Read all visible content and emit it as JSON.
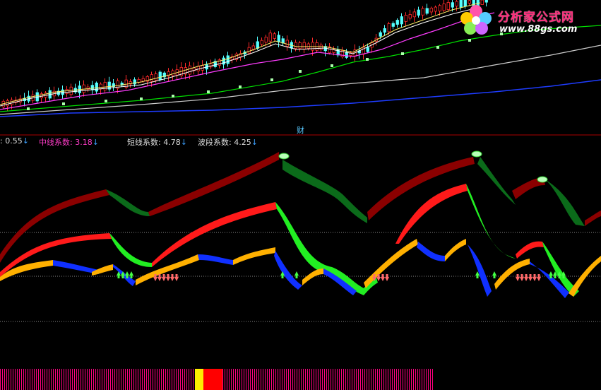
{
  "panel_label": "财",
  "indicators": [
    {
      "label": "",
      "value": ": 0.55",
      "arrow": "↓",
      "color": "#dddddd"
    },
    {
      "label": "中线系数",
      "value": ": 3.18",
      "arrow": "↓",
      "color": "#ff3cc8"
    },
    {
      "label": "短线系数",
      "value": ": 4.78",
      "arrow": "↓",
      "color": "#dddddd"
    },
    {
      "label": "波段系数",
      "value": ": 4.25",
      "arrow": "↓",
      "color": "#dddddd"
    }
  ],
  "watermark": {
    "title": "分析家公式网",
    "url": "www.88gs.com"
  },
  "colors": {
    "background": "#000000",
    "up_candle": "#ff2a2a",
    "down_candle": "#54ffff",
    "ma_short": "#ffffff",
    "ma_mid": "#ff3cff",
    "ma_long": "#00dd00",
    "ma_longer": "#cccccc",
    "ma_longest": "#1e3cff",
    "divider": "#aa0000",
    "arrow": "#3ca0ff",
    "wave_long_up": "#8b0000",
    "wave_long_down": "#0b6b1a",
    "wave_mid_up": "#ff1a1a",
    "wave_mid_down": "#22ee22",
    "wave_short_up": "#ffb000",
    "wave_short_down": "#1030ff"
  }
}
